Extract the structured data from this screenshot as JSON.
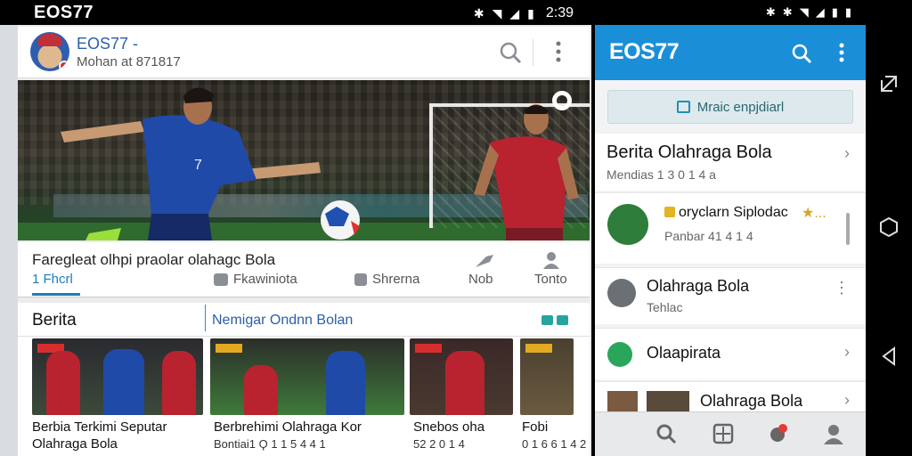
{
  "left_phone": {
    "status_bar": {
      "brand": "EOS77",
      "time": "2:39"
    },
    "app_bar": {
      "title": "EOS77 -",
      "subtitle": "Mohan at 871817"
    },
    "tabs": {
      "heading": "Faregleat olhpi praolar olahagc Bola",
      "items": [
        {
          "label": "1 Fhcrl"
        },
        {
          "label": "Fkawiniota"
        },
        {
          "label": "Shrerna"
        },
        {
          "label": "Nob"
        },
        {
          "label": "Tonto"
        }
      ]
    },
    "news": {
      "section_title": "Berita",
      "section_subtitle": "Nemigar Ondnn Bolan",
      "cards": [
        {
          "title": "Berbia Terkimi Seputar",
          "title2": "Olahraga Bola"
        },
        {
          "title": "Berbrehimi Olahraga Kor",
          "meta": "Bontiai1  Ϙ 1 1  5 4 4 1"
        },
        {
          "title": "Snebos oha",
          "meta": "52 2 0 1 4"
        },
        {
          "title": "Fobi",
          "meta": "0 1 6 6 1 4 2"
        }
      ]
    }
  },
  "right_phone": {
    "app_bar": {
      "brand": "EOS77"
    },
    "action_button": {
      "label": "Mraic enpjdiarl"
    },
    "section": {
      "title": "Berita Olahraga Bola",
      "subtitle": "Mendias 1 3 0 1 4 a"
    },
    "items": [
      {
        "label": "oryclarn Siplodac",
        "sub": "Panbar 41 4 1 4",
        "star": "★..."
      },
      {
        "label": "Olahraga Bola",
        "sub": "Tehlac"
      },
      {
        "label": "Olaapirata"
      },
      {
        "label": "Olahraga Bola"
      }
    ]
  },
  "colors": {
    "accent": "#1a8fd8",
    "link": "#1a7fbf",
    "brand_blue": "#2b5fa8"
  }
}
